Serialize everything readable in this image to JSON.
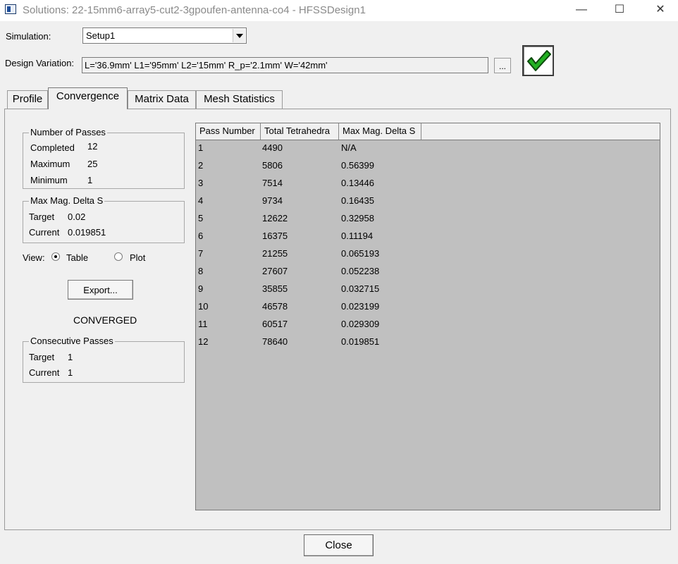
{
  "window": {
    "title": "Solutions: 22-15mm6-array5-cut2-3gpoufen-antenna-co4 - HFSSDesign1",
    "minimize": "—",
    "maximize": "☐",
    "close": "✕"
  },
  "form": {
    "simulation_label": "Simulation:",
    "simulation_value": "Setup1",
    "variation_label": "Design Variation:",
    "variation_value": "L='36.9mm' L1='95mm' L2='15mm' R_p='2.1mm' W='42mm'",
    "browse_label": "...",
    "status_icon": "check-icon",
    "status_color": "#22b022"
  },
  "tabs": [
    {
      "label": "Profile"
    },
    {
      "label": "Convergence"
    },
    {
      "label": "Matrix Data"
    },
    {
      "label": "Mesh Statistics"
    }
  ],
  "passes": {
    "title": "Number of Passes",
    "completed_label": "Completed",
    "completed": "12",
    "maximum_label": "Maximum",
    "maximum": "25",
    "minimum_label": "Minimum",
    "minimum": "1"
  },
  "delta": {
    "title": "Max Mag. Delta S",
    "target_label": "Target",
    "target": "0.02",
    "current_label": "Current",
    "current": "0.019851"
  },
  "view": {
    "label": "View:",
    "table": "Table",
    "plot": "Plot",
    "selected": "Table"
  },
  "export_label": "Export...",
  "status_text": "CONVERGED",
  "consecutive": {
    "title": "Consecutive Passes",
    "target_label": "Target",
    "target": "1",
    "current_label": "Current",
    "current": "1"
  },
  "table": {
    "headers": [
      "Pass Number",
      "Total Tetrahedra",
      "Max Mag. Delta S"
    ],
    "rows": [
      [
        "1",
        "4490",
        "N/A"
      ],
      [
        "2",
        "5806",
        "0.56399"
      ],
      [
        "3",
        "7514",
        "0.13446"
      ],
      [
        "4",
        "9734",
        "0.16435"
      ],
      [
        "5",
        "12622",
        "0.32958"
      ],
      [
        "6",
        "16375",
        "0.11194"
      ],
      [
        "7",
        "21255",
        "0.065193"
      ],
      [
        "8",
        "27607",
        "0.052238"
      ],
      [
        "9",
        "35855",
        "0.032715"
      ],
      [
        "10",
        "46578",
        "0.023199"
      ],
      [
        "11",
        "60517",
        "0.029309"
      ],
      [
        "12",
        "78640",
        "0.019851"
      ]
    ]
  },
  "close_label": "Close"
}
